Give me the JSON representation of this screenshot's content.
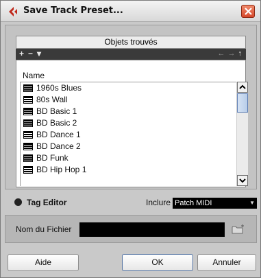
{
  "window": {
    "title": "Save Track Preset..."
  },
  "browser": {
    "header": "Objets trouvés",
    "toolbar": {
      "add": "+",
      "remove": "−",
      "menu": "▾",
      "back": "←",
      "forward": "→",
      "up": "↑"
    },
    "column_name": "Name",
    "items": [
      {
        "label": "1960s Blues"
      },
      {
        "label": "80s Wall"
      },
      {
        "label": "BD Basic 1"
      },
      {
        "label": "BD Basic 2"
      },
      {
        "label": "BD Dance 1"
      },
      {
        "label": "BD Dance 2"
      },
      {
        "label": "BD Funk"
      },
      {
        "label": "BD Hip Hop 1"
      }
    ],
    "scroll_fraction": 0.05
  },
  "tag_editor": {
    "label": "Tag Editor",
    "include_label": "Inclure",
    "include_value": "Patch MIDI"
  },
  "filename": {
    "label": "Nom du Fichier",
    "value": ""
  },
  "buttons": {
    "help": "Aide",
    "ok": "OK",
    "cancel": "Annuler"
  },
  "colors": {
    "brand_red": "#c0281b",
    "selection_black": "#000000"
  }
}
